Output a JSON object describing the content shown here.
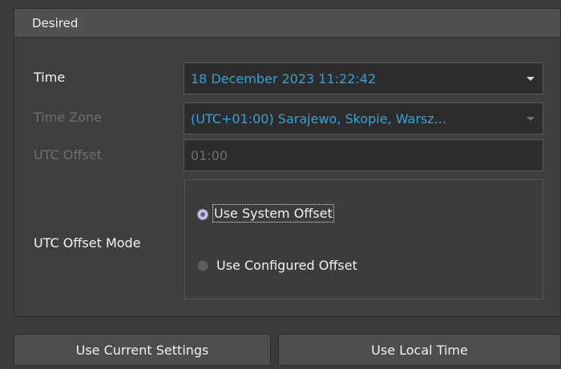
{
  "group": {
    "title": "Desired"
  },
  "time": {
    "label": "Time",
    "value": "18 December 2023 11:22:42"
  },
  "time_zone": {
    "label": "Time Zone",
    "value": "(UTC+01:00) Sarajewo, Skopie, Warsz..."
  },
  "utc_offset": {
    "label": "UTC Offset",
    "value": "01:00"
  },
  "utc_offset_mode": {
    "label": "UTC Offset Mode",
    "options": [
      {
        "label": "Use System Offset",
        "selected": true
      },
      {
        "label": "Use Configured Offset",
        "selected": false
      }
    ]
  },
  "buttons": {
    "use_current": "Use Current Settings",
    "use_local": "Use Local Time"
  },
  "colors": {
    "accent_value": "#2fa4dd",
    "enabled_text": "#f3f3f3",
    "disabled_text": "#6f6f6f"
  },
  "icons": [
    "dropdown-arrow-icon",
    "radio-checked-icon",
    "radio-unchecked-icon"
  ]
}
